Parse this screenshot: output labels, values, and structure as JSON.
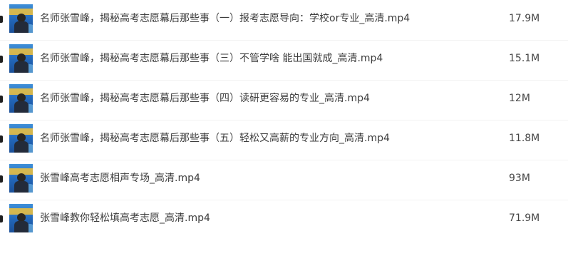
{
  "files": [
    {
      "name": "名师张雪峰，揭秘高考志愿幕后那些事（一）报考志愿导向：学校or专业_高清.mp4",
      "size": "17.9M",
      "icon": "video-thumbnail"
    },
    {
      "name": "名师张雪峰，揭秘高考志愿幕后那些事（三）不管学啥 能出国就成_高清.mp4",
      "size": "15.1M",
      "icon": "video-thumbnail"
    },
    {
      "name": "名师张雪峰，揭秘高考志愿幕后那些事（四）读研更容易的专业_高清.mp4",
      "size": "12M",
      "icon": "video-thumbnail"
    },
    {
      "name": "名师张雪峰，揭秘高考志愿幕后那些事（五）轻松又高薪的专业方向_高清.mp4",
      "size": "11.8M",
      "icon": "video-thumbnail"
    },
    {
      "name": "张雪峰高考志愿相声专场_高清.mp4",
      "size": "93M",
      "icon": "video-thumbnail"
    },
    {
      "name": "张雪峰教你轻松填高考志愿_高清.mp4",
      "size": "71.9M",
      "icon": "video-thumbnail"
    }
  ],
  "colors": {
    "text": "#3d3d3d",
    "thumbnail_blue": "#2266b8",
    "thumbnail_yellow": "#f2c23a"
  }
}
